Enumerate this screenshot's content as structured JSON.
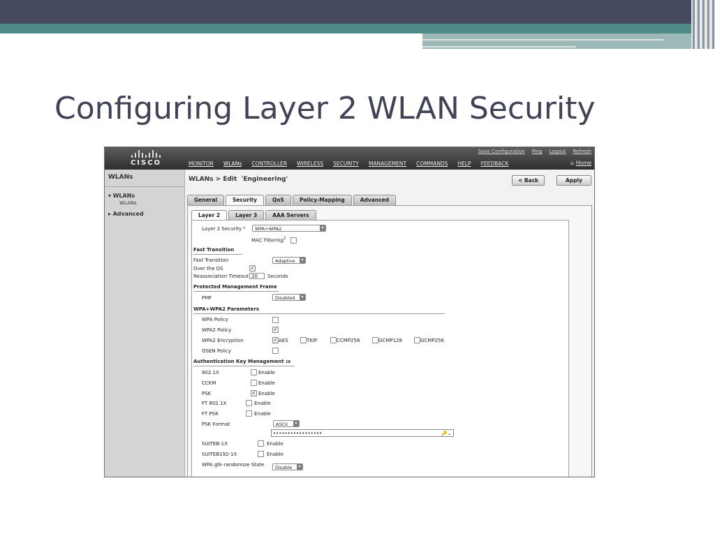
{
  "slide": {
    "title": "Configuring Layer 2 WLAN Security"
  },
  "header": {
    "logo_text": "CISCO",
    "util_links": [
      "Save Configuration",
      "Ping",
      "Logout",
      "Refresh"
    ],
    "home": "Home",
    "nav": [
      "MONITOR",
      "WLANs",
      "CONTROLLER",
      "WIRELESS",
      "SECURITY",
      "MANAGEMENT",
      "COMMANDS",
      "HELP",
      "FEEDBACK"
    ]
  },
  "sidebar": {
    "title": "WLANs",
    "items": [
      {
        "label": "WLANs",
        "expanded": true
      },
      {
        "label": "WLANs"
      },
      {
        "label": "Advanced",
        "expanded": false
      }
    ]
  },
  "page": {
    "title": "WLANs > Edit",
    "wlan_name": "'Engineering'",
    "back_button": "< Back",
    "apply_button": "Apply"
  },
  "tabs": [
    "General",
    "Security",
    "QoS",
    "Policy-Mapping",
    "Advanced"
  ],
  "subtabs": [
    "Layer 2",
    "Layer 3",
    "AAA Servers"
  ],
  "form": {
    "layer2_security_label": "Layer 2 Security",
    "layer2_security_value": "WPA+WPA2",
    "mac_filtering_label": "MAC Filtering",
    "fast_transition_section": "Fast Transition",
    "fast_transition_label": "Fast Transition",
    "fast_transition_value": "Adaptive",
    "over_ds_label": "Over the DS",
    "reassoc_label": "Reassociation Timeout",
    "reassoc_value": "20",
    "reassoc_unit": "Seconds",
    "pmf_section": "Protected Management Frame",
    "pmf_label": "PMF",
    "pmf_value": "Disabled",
    "wpa_section": "WPA+WPA2 Parameters",
    "wpa_policy_label": "WPA Policy",
    "wpa2_policy_label": "WPA2 Policy",
    "wpa2_encryption_label": "WPA2 Encryption",
    "enc_options": [
      "AES",
      "TKIP",
      "CCMP256",
      "GCMP128",
      "GCMP256"
    ],
    "osen_label": "OSEN Policy",
    "akm_section": "Authentication Key Management",
    "akm_rows": [
      {
        "label": "802.1X",
        "enable": "Enable",
        "checked": false
      },
      {
        "label": "CCKM",
        "enable": "Enable",
        "checked": false
      },
      {
        "label": "PSK",
        "enable": "Enable",
        "checked": true
      },
      {
        "label": "FT 802.1X",
        "enable": "Enable",
        "checked": false
      },
      {
        "label": "FT PSK",
        "enable": "Enable",
        "checked": false
      }
    ],
    "psk_format_label": "PSK Format",
    "psk_format_value": "ASCII",
    "psk_value": "•••••••••••••••••",
    "suiteb_rows": [
      {
        "label": "SUITEB-1X",
        "enable": "Enable"
      },
      {
        "label": "SUITEB192-1X",
        "enable": "Enable"
      }
    ],
    "gtk_label": "WPA gtk-randomize State",
    "gtk_value": "Disable"
  }
}
